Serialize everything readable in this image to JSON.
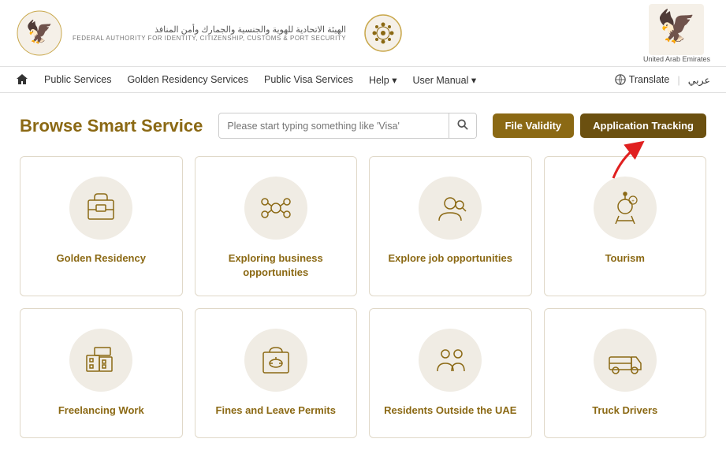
{
  "header": {
    "logo_arabic": "الهيئة الاتحادية للهوية والجنسية والجمارك وأمن المنافذ",
    "logo_english": "FEDERAL AUTHORITY FOR IDENTITY, CITIZENSHIP, CUSTOMS & PORT SECURITY",
    "uae_label": "United Arab Emirates"
  },
  "navbar": {
    "home_label": "",
    "items": [
      {
        "label": "Public Services"
      },
      {
        "label": "Golden Residency Services"
      },
      {
        "label": "Public Visa Services"
      },
      {
        "label": "Help ▾"
      },
      {
        "label": "User Manual ▾"
      }
    ],
    "translate_label": "Translate",
    "arabic_label": "عربي"
  },
  "main": {
    "browse_title": "Browse Smart Service",
    "search_placeholder": "Please start typing something like 'Visa'",
    "file_validity_label": "File Validity",
    "app_tracking_label": "Application Tracking"
  },
  "services": [
    {
      "id": "golden-residency",
      "label": "Golden Residency",
      "icon": "golden-residency-icon"
    },
    {
      "id": "exploring-business",
      "label": "Exploring business opportunities",
      "icon": "business-icon"
    },
    {
      "id": "explore-job",
      "label": "Explore job opportunities",
      "icon": "job-icon"
    },
    {
      "id": "tourism",
      "label": "Tourism",
      "icon": "tourism-icon"
    },
    {
      "id": "freelancing-work",
      "label": "Freelancing Work",
      "icon": "freelancing-icon"
    },
    {
      "id": "fines-leave",
      "label": "Fines and Leave Permits",
      "icon": "fines-icon"
    },
    {
      "id": "residents-outside",
      "label": "Residents Outside the UAE",
      "icon": "residents-icon"
    },
    {
      "id": "truck-drivers",
      "label": "Truck Drivers",
      "icon": "truck-icon"
    }
  ],
  "colors": {
    "brand_gold": "#8B6914",
    "brand_dark_gold": "#6B5010",
    "icon_bg": "#f0ece4"
  }
}
